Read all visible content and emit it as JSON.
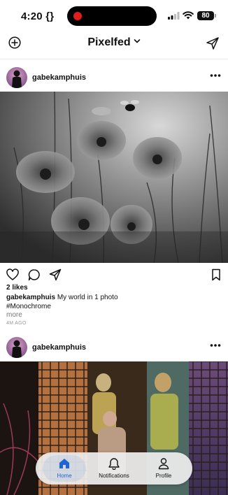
{
  "status_bar": {
    "time": "4:20",
    "time_icon": "braces-icon",
    "battery": "80"
  },
  "header": {
    "title": "Pixelfed",
    "add_icon": "plus-circle-icon",
    "send_icon": "paper-plane-icon"
  },
  "posts": [
    {
      "username": "gabekamphuis",
      "likes": "2 likes",
      "caption_user": "gabekamphuis",
      "caption_text": "My world in 1 photo",
      "hashtag": "#Monochrome",
      "more_label": "more",
      "time_ago": "4M AGO",
      "photo": "black-and-white poppy field with bee"
    },
    {
      "username": "gabekamphuis",
      "photo": "projected image of children on building windows"
    }
  ],
  "tabbar": {
    "tabs": [
      {
        "label": "Home",
        "icon": "home-icon",
        "active": true
      },
      {
        "label": "Notifications",
        "icon": "bell-icon",
        "active": false
      },
      {
        "label": "Profile",
        "icon": "person-icon",
        "active": false
      }
    ],
    "accent": "#1f66d1"
  }
}
